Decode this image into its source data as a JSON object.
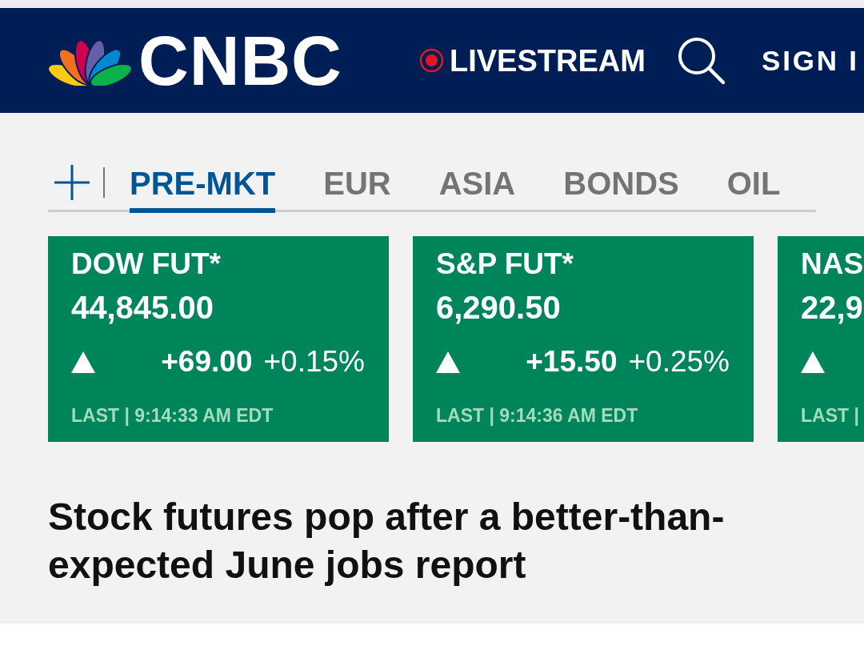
{
  "header": {
    "logo_text": "CNBC",
    "livestream": "LIVESTREAM",
    "sign_in": "SIGN I"
  },
  "market_tabs": [
    {
      "label": "PRE-MKT",
      "selected": true
    },
    {
      "label": "EUR",
      "selected": false
    },
    {
      "label": "ASIA",
      "selected": false
    },
    {
      "label": "BONDS",
      "selected": false
    },
    {
      "label": "OIL",
      "selected": false
    }
  ],
  "quotes": [
    {
      "kind": "up",
      "name": "DOW FUT*",
      "price": "44,845.00",
      "change": "+69.00",
      "change_percent": "+0.15%",
      "last_updated": "LAST | 9:14:33 AM EDT"
    },
    {
      "kind": "up",
      "name": "S&P FUT*",
      "price": "6,290.50",
      "change": "+15.50",
      "change_percent": "+0.25%",
      "last_updated": "LAST | 9:14:36 AM EDT"
    },
    {
      "kind": "up",
      "name": "NAS",
      "price": "22,9",
      "last_updated": "LAST |"
    }
  ],
  "headline": "Stock futures pop after a better-than-expected June jobs report"
}
